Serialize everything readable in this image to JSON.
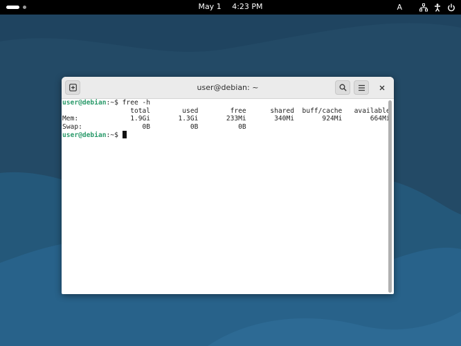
{
  "topbar": {
    "activities_icon": "activities-pill-icon",
    "date": "May 1",
    "time": "4:23 PM",
    "input_method": "A",
    "tray_icons": [
      "network-icon",
      "accessibility-icon",
      "power-icon"
    ]
  },
  "window": {
    "title": "user@debian: ~",
    "new_tab_icon": "new-tab-icon",
    "search_icon": "search-icon",
    "menu_icon": "hamburger-menu-icon",
    "close_icon": "close-icon"
  },
  "terminal": {
    "prompt": "user@debian",
    "prompt_suffix": ":~$ ",
    "command": "free -h",
    "header": "                 total        used        free      shared  buff/cache   available",
    "mem_row": "Mem:             1.9Gi       1.3Gi       233Mi       340Mi       924Mi       664Mi",
    "swap_row": "Swap:               0B          0B          0B",
    "prompt2": "user@debian",
    "prompt2_suffix": ":~$ "
  },
  "colors": {
    "prompt": "#2a9a6a",
    "desktop": "#254b67",
    "topbar": "#000000"
  }
}
